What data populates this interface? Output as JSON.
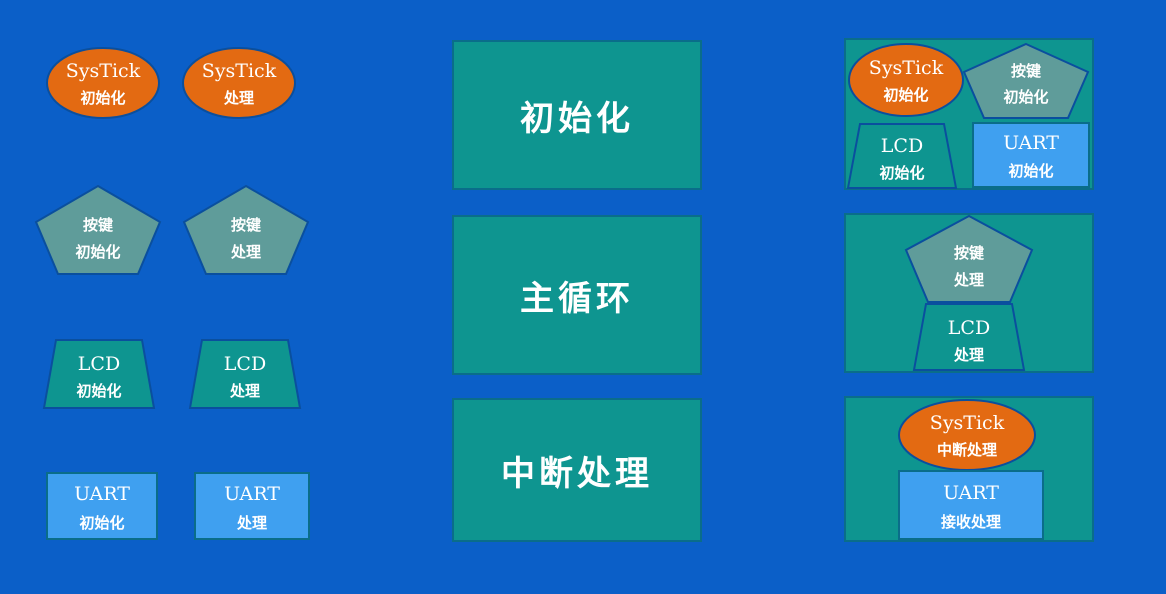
{
  "colors": {
    "background": "#0b5fc8",
    "teal": "#0e9590",
    "orange": "#e36a12",
    "gray": "#5f9c9a",
    "light_blue": "#3fa0f0"
  },
  "legend": {
    "systick_init": {
      "line1": "SysTick",
      "line2": "初始化"
    },
    "systick_proc": {
      "line1": "SysTick",
      "line2": "处理"
    },
    "key_init": {
      "line1": "按键",
      "line2": "初始化"
    },
    "key_proc": {
      "line1": "按键",
      "line2": "处理"
    },
    "lcd_init": {
      "line1": "LCD",
      "line2": "初始化"
    },
    "lcd_proc": {
      "line1": "LCD",
      "line2": "处理"
    },
    "uart_init": {
      "line1": "UART",
      "line2": "初始化"
    },
    "uart_proc": {
      "line1": "UART",
      "line2": "处理"
    }
  },
  "stages": {
    "init": "初始化",
    "main_loop": "主循环",
    "interrupt": "中断处理"
  },
  "panels": {
    "init": {
      "systick": {
        "line1": "SysTick",
        "line2": "初始化"
      },
      "key": {
        "line1": "按键",
        "line2": "初始化"
      },
      "lcd": {
        "line1": "LCD",
        "line2": "初始化"
      },
      "uart": {
        "line1": "UART",
        "line2": "初始化"
      }
    },
    "main_loop": {
      "key": {
        "line1": "按键",
        "line2": "处理"
      },
      "lcd": {
        "line1": "LCD",
        "line2": "处理"
      }
    },
    "interrupt": {
      "systick": {
        "line1": "SysTick",
        "line2": "中断处理"
      },
      "uart": {
        "line1": "UART",
        "line2": "接收处理"
      }
    }
  }
}
